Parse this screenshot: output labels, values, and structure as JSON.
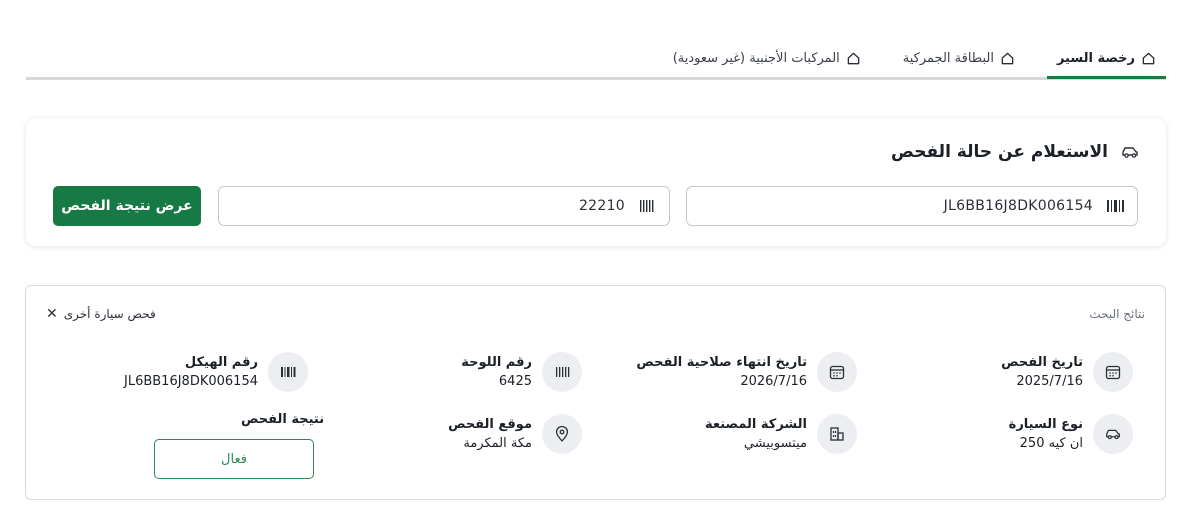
{
  "tabs": [
    {
      "label": "رخصة السير",
      "active": true
    },
    {
      "label": "البطاقة الجمركية",
      "active": false
    },
    {
      "label": "المركبات الأجنبية (غير سعودية)",
      "active": false
    }
  ],
  "search": {
    "title": "الاستعلام عن حالة الفحص",
    "vin_value": "JL6BB16J8DK006154",
    "plate_value": "22210",
    "submit_label": "عرض نتيجة الفحص"
  },
  "results": {
    "label": "نتائج البحث",
    "reset_label": "فحص سيارة أخرى",
    "inspection_date": {
      "label": "تاريخ الفحص",
      "value": "2025/7/16"
    },
    "expiry_date": {
      "label": "تاريخ انتهاء صلاحية الفحص",
      "value": "2026/7/16"
    },
    "plate_number": {
      "label": "رقم اللوحة",
      "value": "6425"
    },
    "chassis_number": {
      "label": "رقم الهيكل",
      "value": "JL6BB16J8DK006154"
    },
    "car_type": {
      "label": "نوع السيارة",
      "value": "ان كيه 250"
    },
    "manufacturer": {
      "label": "الشركة المصنعة",
      "value": "ميتسوبيشي"
    },
    "location": {
      "label": "موقع الفحص",
      "value": "مكة المكرمة"
    },
    "result_title": "نتيجة الفحص",
    "result_status": "فعال"
  },
  "colors": {
    "accent": "#177a44",
    "status": "#2b8a52"
  },
  "icons": [
    "home-icon",
    "car-icon",
    "barcode-icon",
    "plate-icon",
    "calendar-icon",
    "building-icon",
    "location-pin-icon",
    "close-icon"
  ]
}
